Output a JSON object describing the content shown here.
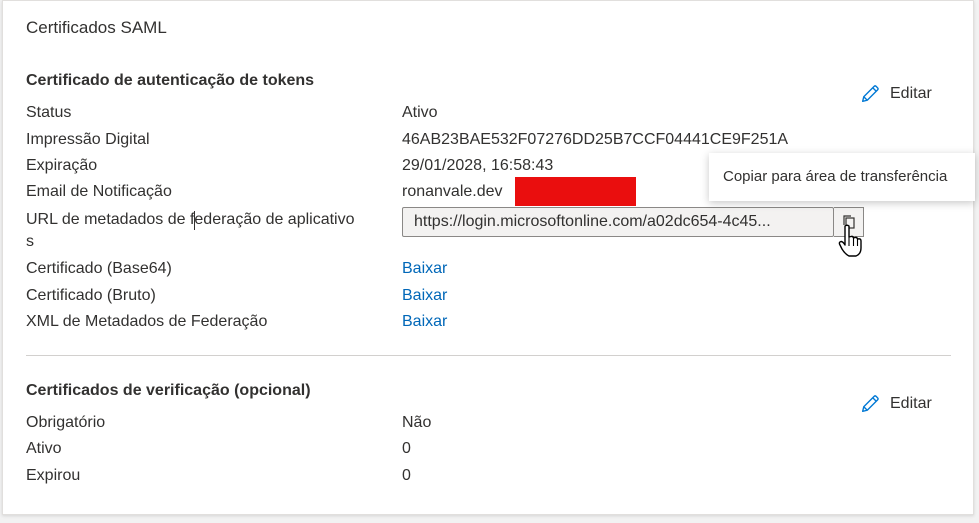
{
  "card": {
    "title": "Certificados SAML"
  },
  "token_cert": {
    "section_title": "Certificado de autenticação de tokens",
    "edit_label": "Editar",
    "rows": [
      {
        "label": "Status",
        "value": "Ativo"
      },
      {
        "label": "Impressão Digital",
        "value": "46AB23BAE532F07276DD25B7CCF04441CE9F251A"
      },
      {
        "label": "Expiração",
        "value": "29/01/2028, 16:58:43"
      },
      {
        "label": "Email de Notificação",
        "value": "ronanvale.dev"
      },
      {
        "label": "URL de metadados de federação de aplicativo",
        "label_wrap": "s",
        "value": "https://login.microsoftonline.com/a02dc654-4c45..."
      },
      {
        "label": "Certificado (Base64)",
        "value": "Baixar"
      },
      {
        "label": "Certificado (Bruto)",
        "value": "Baixar"
      },
      {
        "label": "XML de Metadados de Federação",
        "value": "Baixar"
      }
    ],
    "copy_tooltip": "Copiar para área de transferência"
  },
  "verify_cert": {
    "section_title": "Certificados de verificação (opcional)",
    "edit_label": "Editar",
    "rows": [
      {
        "label": "Obrigatório",
        "value": "Não"
      },
      {
        "label": "Ativo",
        "value": "0"
      },
      {
        "label": "Expirou",
        "value": "0"
      }
    ]
  },
  "icons": {
    "edit": "pencil-icon",
    "copy": "copy-icon",
    "cursor": "hand-pointer-icon"
  },
  "colors": {
    "link": "#0067b8",
    "edit_icon": "#0078d4",
    "redaction": "#ea0e0e"
  }
}
